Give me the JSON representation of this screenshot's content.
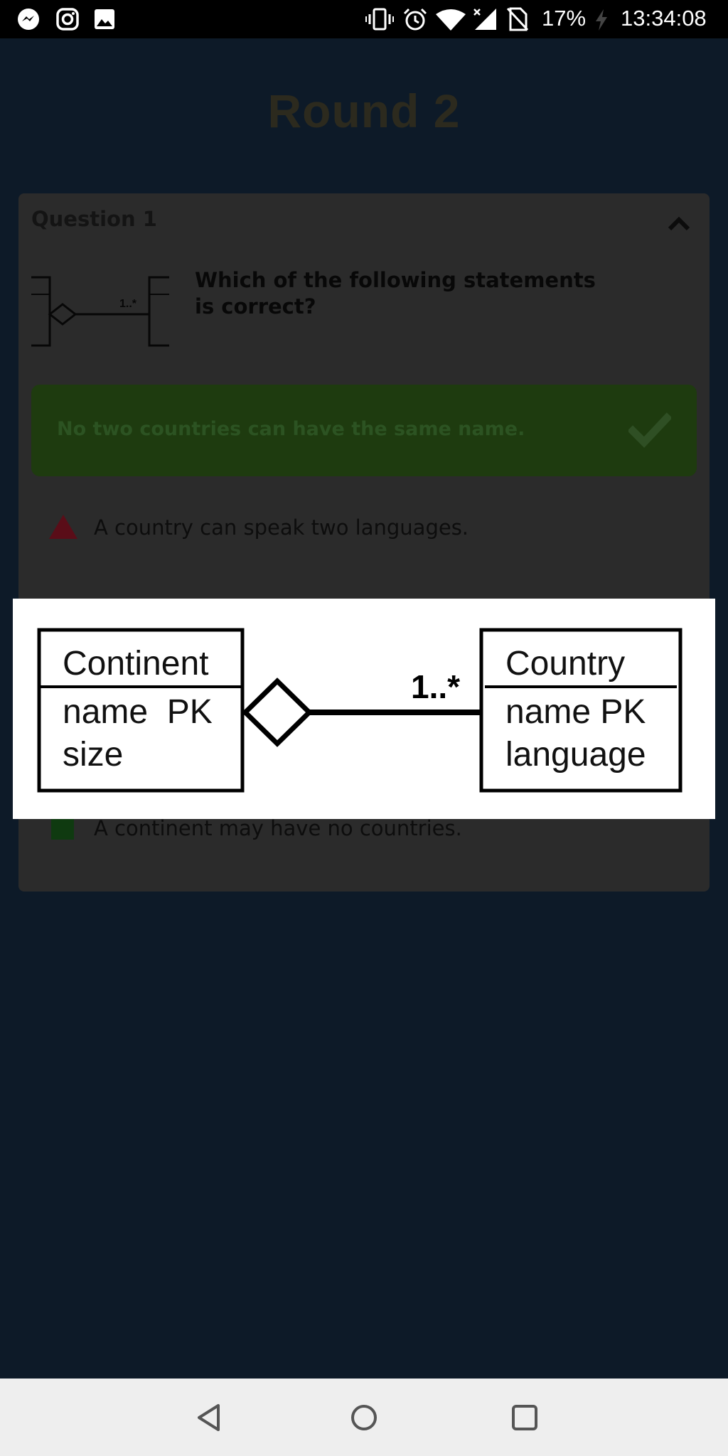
{
  "status_bar": {
    "battery": "17%",
    "time": "13:34:08"
  },
  "header": {
    "title": "Round 2"
  },
  "question": {
    "label": "Question 1",
    "text": "Which of the following statements is correct?"
  },
  "options": {
    "correct": "No two countries can have the same name.",
    "wrong": "A country can speak two languages.",
    "other": "A continent may have no countries."
  },
  "diagram": {
    "left_entity": {
      "name": "Continent",
      "attr1": "name  PK",
      "attr2": "size"
    },
    "right_entity": {
      "name": "Country",
      "attr1": "name PK",
      "attr2": "language"
    },
    "multiplicity": "1..*"
  },
  "colors": {
    "correct_bg": "#1e3b0f",
    "wrong_marker": "#5a0d18",
    "other_marker": "#0f3a10"
  },
  "icons": {
    "messenger": "messenger-icon",
    "instagram": "instagram-icon",
    "gallery": "gallery-icon",
    "vibrate": "vibrate-icon",
    "alarm": "alarm-icon",
    "wifi": "wifi-icon",
    "signal": "signal-icon",
    "no_sim": "no-sim-icon",
    "charging": "charging-icon",
    "collapse": "chevron-up-icon",
    "check": "checkmark-icon",
    "back": "back-icon",
    "home": "home-icon",
    "recents": "recents-icon"
  }
}
